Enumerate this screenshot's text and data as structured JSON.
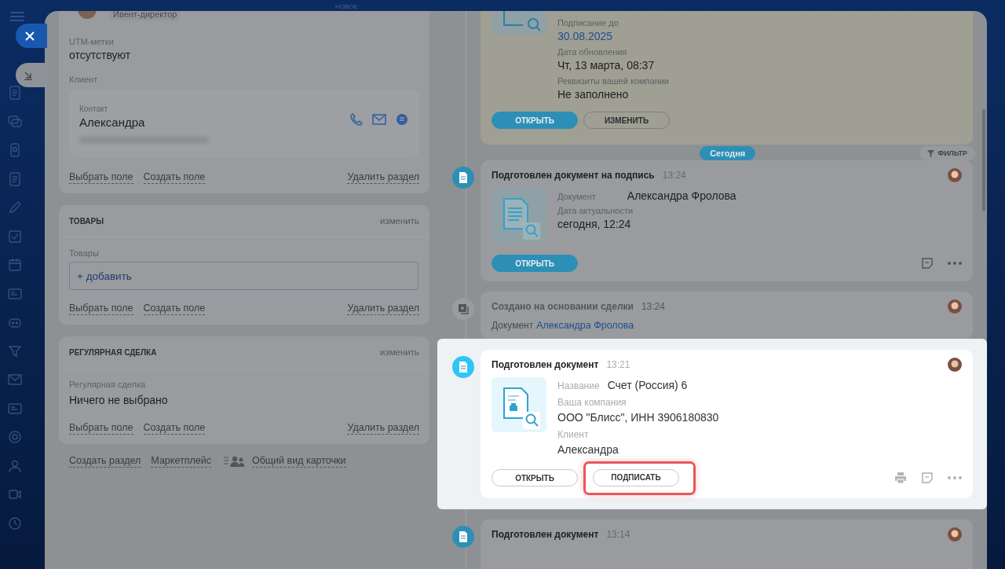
{
  "top_bar": {
    "label": "НОВОЕ"
  },
  "main_section": {
    "role": "Ивент-директор",
    "utm_label": "UTM-метки",
    "utm_value": "отсутствуют",
    "client_label": "Клиент",
    "contact_label": "Контакт",
    "contact_name": "Александра",
    "actions": [
      "Выбрать поле",
      "Создать поле"
    ],
    "delete": "Удалить раздел"
  },
  "sections": [
    {
      "title": "ТОВАРЫ",
      "edit": "изменить",
      "field_label": "Товары",
      "kind": "add",
      "value": "+ добавить",
      "actions": [
        "Выбрать поле",
        "Создать поле"
      ],
      "delete": "Удалить раздел"
    },
    {
      "title": "РЕГУЛЯРНАЯ СДЕЛКА",
      "edit": "изменить",
      "field_label": "Регулярная сделка",
      "kind": "text",
      "value": "Ничего не выбрано",
      "actions": [
        "Выбрать поле",
        "Создать поле"
      ],
      "delete": "Удалить раздел"
    }
  ],
  "footer_links": [
    {
      "label": "Создать раздел",
      "kind": "link"
    },
    {
      "label": "Маркетплейс",
      "kind": "link"
    },
    {
      "label": "Общий вид карточки",
      "kind": "people"
    }
  ],
  "pinned": {
    "fields": [
      {
        "label": "Подписание до",
        "value": "30.08.2025",
        "kind": "link"
      },
      {
        "label": "Дата обновления",
        "value": "Чт, 13 марта, 08:37",
        "kind": "text"
      },
      {
        "label": "Реквизиты вашей компании",
        "value": "Не заполнено",
        "kind": "text"
      }
    ],
    "buttons": [
      {
        "label": "ОТКРЫТЬ",
        "primary": true
      },
      {
        "label": "ИЗМЕНИТЬ",
        "primary": false
      }
    ]
  },
  "date_badge": "Сегодня",
  "filter": "ФИЛЬТР",
  "events": [
    {
      "kind": "document",
      "title": "Подготовлен документ на подпись",
      "time": "13:24",
      "highlighted": false,
      "thumb": {
        "kind": "lines"
      },
      "fields": [
        {
          "label": "Документ",
          "value": "Александра Фролова",
          "inline": true
        },
        {
          "label": "Дата актуальности",
          "value": "сегодня, 12:24",
          "inline": false
        }
      ],
      "buttons": [
        {
          "label": "ОТКРЫТЬ",
          "primary": true,
          "highlighted": false
        }
      ],
      "tools": [
        {
          "kind": "note"
        },
        {
          "kind": "more"
        }
      ]
    },
    {
      "kind": "created",
      "title": "Создано на основании сделки",
      "time": "13:24",
      "highlighted": false,
      "doc_label": "Документ",
      "doc_link": "Александра Фролова"
    },
    {
      "kind": "document",
      "title": "Подготовлен документ",
      "time": "13:21",
      "highlighted": true,
      "thumb": {
        "kind": "printer"
      },
      "fields": [
        {
          "label": "Название",
          "value": "Счет (Россия) 6",
          "inline": true
        },
        {
          "label": "Ваша компания",
          "value": "ООО \"Блисс\", ИНН 3906180830",
          "inline": false
        },
        {
          "label": "Клиент",
          "value": "Александра",
          "inline": false
        }
      ],
      "buttons": [
        {
          "label": "ОТКРЫТЬ",
          "primary": false,
          "highlighted": false
        },
        {
          "label": "ПОДПИСАТЬ",
          "primary": false,
          "highlighted": true
        }
      ],
      "tools": [
        {
          "kind": "print"
        },
        {
          "kind": "note"
        },
        {
          "kind": "more"
        }
      ]
    },
    {
      "kind": "document",
      "title": "Подготовлен документ",
      "time": "13:14",
      "highlighted": false
    }
  ]
}
